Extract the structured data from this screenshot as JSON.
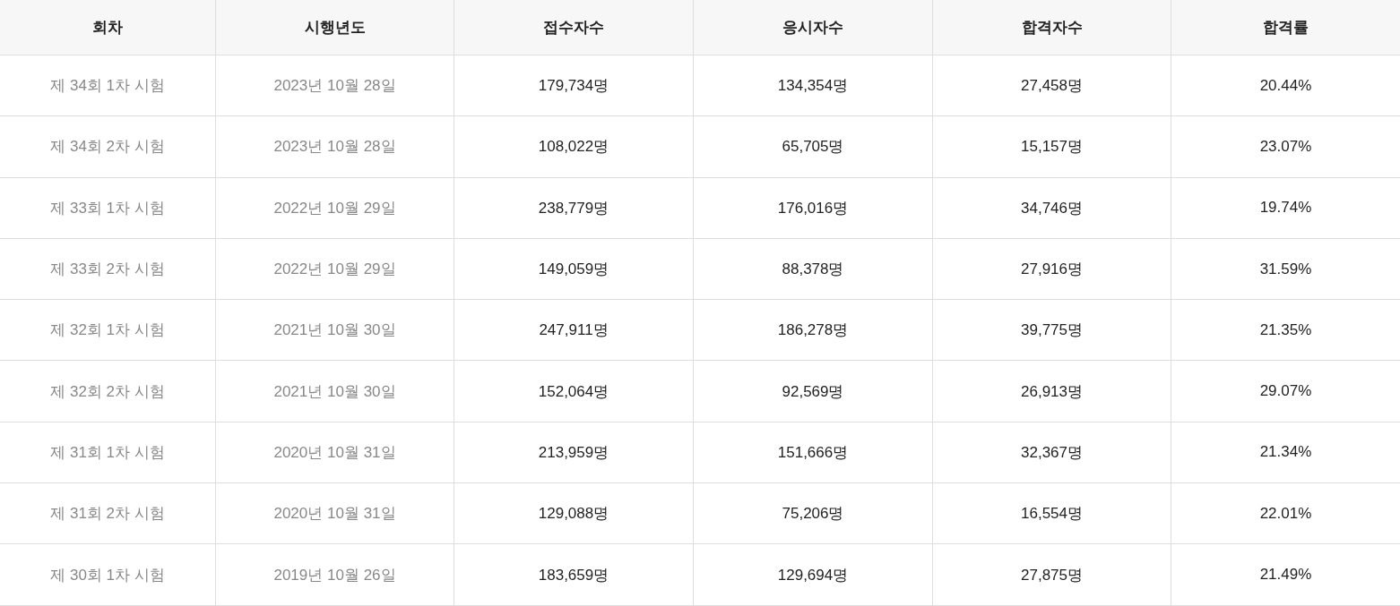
{
  "table": {
    "columns": [
      "회차",
      "시행년도",
      "접수자수",
      "응시자수",
      "합격자수",
      "합격률"
    ],
    "rows": [
      [
        "제 34회 1차 시험",
        "2023년 10월 28일",
        "179,734명",
        "134,354명",
        "27,458명",
        "20.44%"
      ],
      [
        "제 34회 2차 시험",
        "2023년 10월 28일",
        "108,022명",
        "65,705명",
        "15,157명",
        "23.07%"
      ],
      [
        "제 33회 1차 시험",
        "2022년 10월 29일",
        "238,779명",
        "176,016명",
        "34,746명",
        "19.74%"
      ],
      [
        "제 33회 2차 시험",
        "2022년 10월 29일",
        "149,059명",
        "88,378명",
        "27,916명",
        "31.59%"
      ],
      [
        "제 32회 1차 시험",
        "2021년 10월 30일",
        "247,911명",
        "186,278명",
        "39,775명",
        "21.35%"
      ],
      [
        "제 32회 2차 시험",
        "2021년 10월 30일",
        "152,064명",
        "92,569명",
        "26,913명",
        "29.07%"
      ],
      [
        "제 31회 1차 시험",
        "2020년 10월 31일",
        "213,959명",
        "151,666명",
        "32,367명",
        "21.34%"
      ],
      [
        "제 31회 2차 시험",
        "2020년 10월 31일",
        "129,088명",
        "75,206명",
        "16,554명",
        "22.01%"
      ],
      [
        "제 30회 1차 시험",
        "2019년 10월 26일",
        "183,659명",
        "129,694명",
        "27,875명",
        "21.49%"
      ]
    ]
  }
}
